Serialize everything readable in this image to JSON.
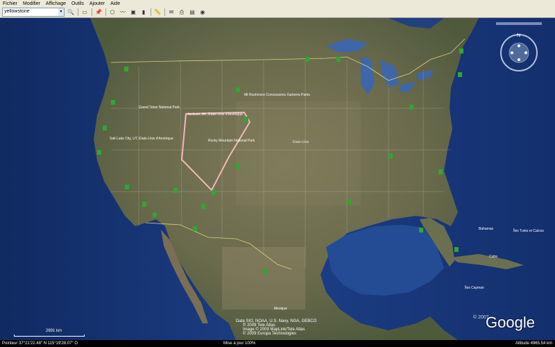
{
  "menu": [
    "Fichier",
    "Modifier",
    "Affichage",
    "Outils",
    "Ajouter",
    "Aide"
  ],
  "search": {
    "value": "yellowstone"
  },
  "map": {
    "labels": {
      "jackson": "Jackson, AK, États-Unis d'Amérique",
      "rocky": "Rocky Mountain National Park",
      "saltlake": "Salt Lake City, UT, États-Unis d'Amérique",
      "rushmore": "Mt Rushmore Concessions Xanterra Parks",
      "grandteton": "Grand Teton National Park",
      "usa": "États-Unis",
      "bahamas": "Bahamas",
      "caicos": "Îles Turks et Caïcos",
      "cayman": "Îles Cayman",
      "cuba": "Cuba",
      "mexique": "Mexique"
    },
    "attribution": [
      "Data SIO, NOAA, U.S. Navy, NGA, GEBCO",
      "© 2009 Tele Atlas",
      "Image © 2009 MapLink/Tele Atlas",
      "© 2009 Europa Technologies"
    ],
    "logo": "Google",
    "logo_year": "© 2007",
    "scale": "2691 km"
  },
  "status": {
    "pointer": "Pointeur 37°21'22.48\" N   115°19'28.07\" O",
    "stream": "Mise à jour   100%",
    "altitude": "Altitude  4965.54 km"
  },
  "colors": {
    "ocean": "#1b3a7a",
    "land": "#6b6b4e",
    "border": "#d9d27a",
    "route": "#f4b7b7",
    "marker": "#2ea82e"
  }
}
